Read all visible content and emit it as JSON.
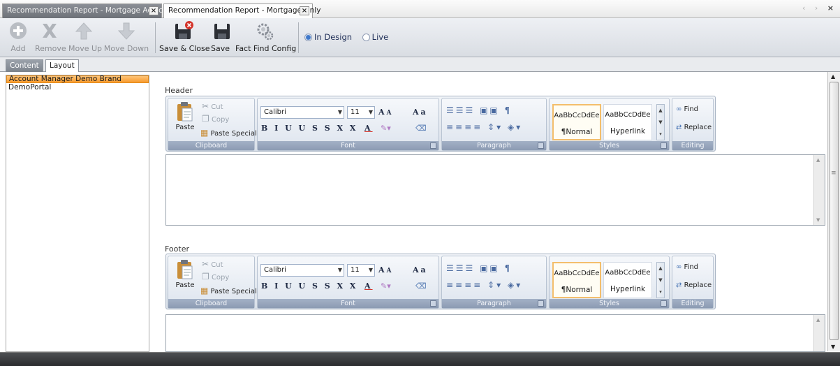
{
  "tabs": [
    {
      "label": "Recommendation Report - Mortgage Advice",
      "active": false
    },
    {
      "label": "Recommendation Report - Mortgage Only",
      "active": true
    }
  ],
  "tab_close_glyph": "×",
  "nav": {
    "left": "‹",
    "right": "›",
    "close": "×"
  },
  "toolbar": {
    "add_label": "Add",
    "remove_label": "Remove",
    "move_up_label": "Move Up",
    "move_down_label": "Move Down",
    "save_close_label": "Save & Close",
    "save_label": "Save",
    "fact_find_label": "Fact Find Config",
    "mode_in_design": "In Design",
    "mode_live": "Live",
    "selected_mode": "In Design"
  },
  "inner_tabs": [
    {
      "label": "Content",
      "active": false
    },
    {
      "label": "Layout",
      "active": true
    }
  ],
  "brands": [
    {
      "label": "Account Manager Demo Brand",
      "selected": true
    },
    {
      "label": "DemoPortal",
      "selected": false
    }
  ],
  "header_label": "Header",
  "footer_label": "Footer",
  "ribbon": {
    "paste": "Paste",
    "cut": "Cut",
    "copy": "Copy",
    "paste_special": "Paste Special",
    "clipboard_caption": "Clipboard",
    "font_name": "Calibri",
    "font_size": "11",
    "grow_font": "A",
    "shrink_font": "A",
    "change_case": "Aa",
    "format_buttons": "B I U U S S X X",
    "font_color_letter": "A",
    "font_caption": "Font",
    "paragraph_caption": "Paragraph",
    "pilcrow": "¶",
    "style_normal_sample": "AaBbCcDdEe",
    "style_normal_name": "¶Normal",
    "style_hyperlink_sample": "AaBbCcDdEe",
    "style_hyperlink_name": "Hyperlink",
    "styles_caption": "Styles",
    "find": "Find",
    "replace": "Replace",
    "editing_caption": "Editing"
  },
  "colors": {
    "accent_orange": "#f79a2d",
    "ribbon_caption": "#8c9bb3",
    "save_red": "#d4342b"
  }
}
